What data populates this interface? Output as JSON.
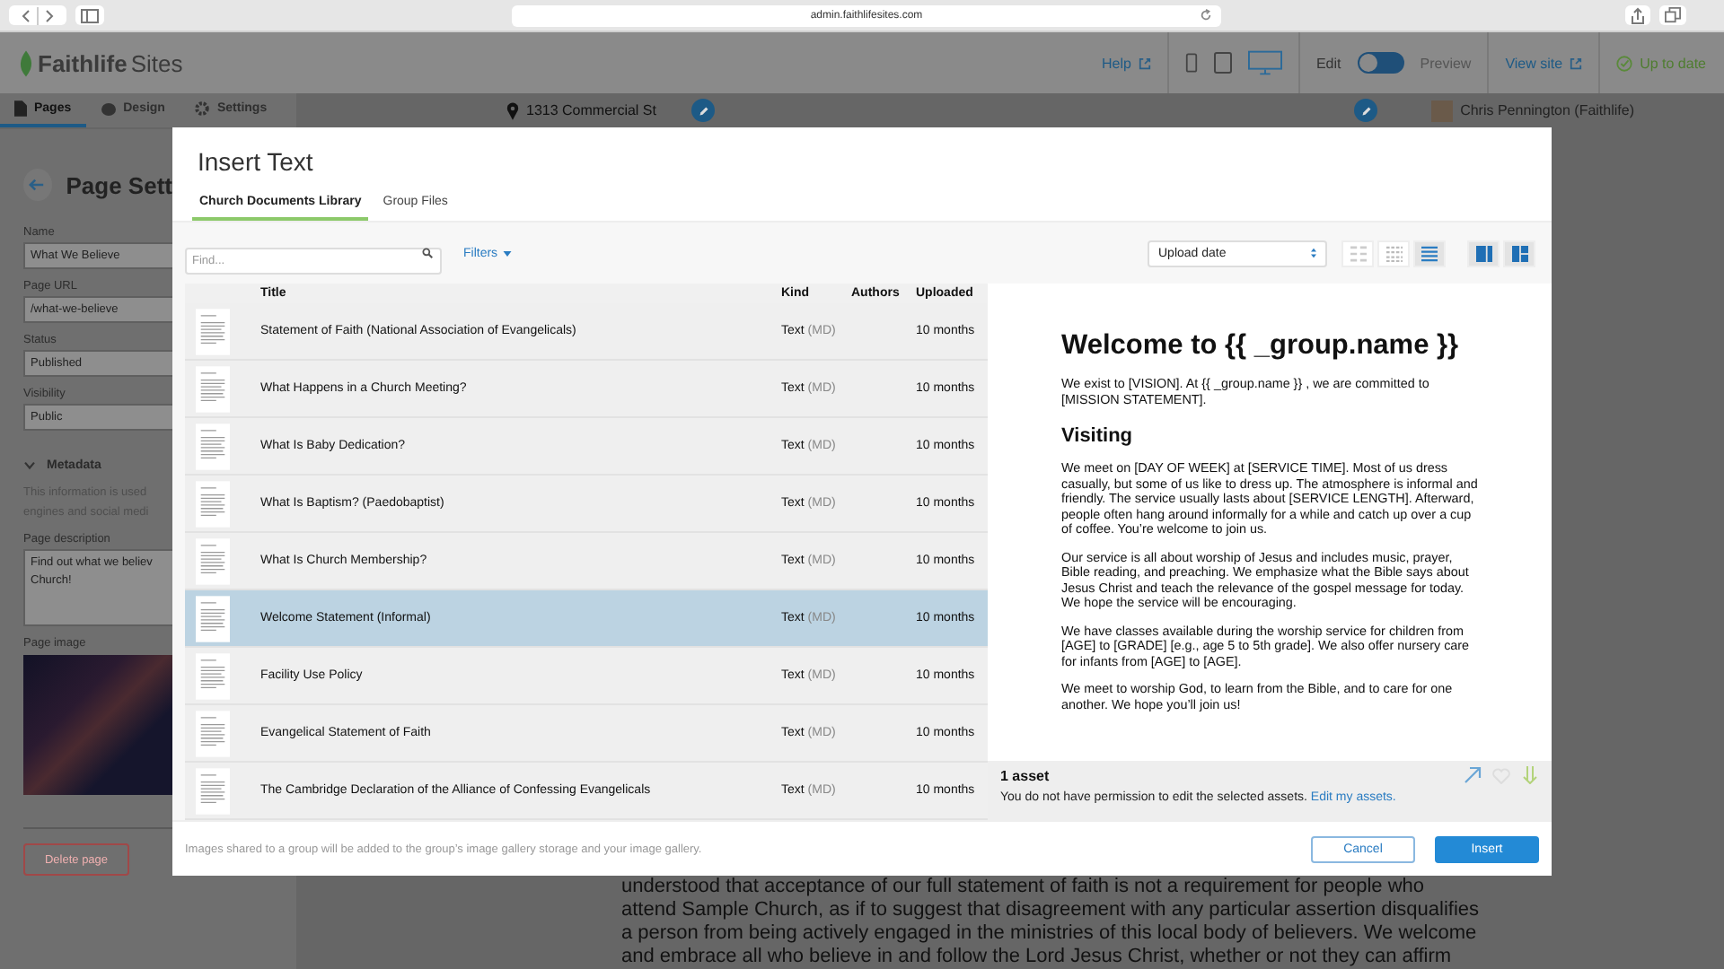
{
  "browser": {
    "url": "admin.faithlifesites.com"
  },
  "app_header": {
    "logo_bold": "Faithlife",
    "logo_light": "Sites",
    "help": "Help",
    "devices": [
      {
        "kind": "phone",
        "selected": false
      },
      {
        "kind": "tablet",
        "selected": false
      },
      {
        "kind": "desktop",
        "selected": true
      }
    ],
    "edit_label": "Edit",
    "preview_label": "Preview",
    "preview_mode": false,
    "view_site": "View site",
    "status": "Up to date"
  },
  "sidebar": {
    "tabs": [
      {
        "kind": "pages",
        "label": "Pages",
        "selected": true
      },
      {
        "kind": "design",
        "label": "Design",
        "selected": false
      },
      {
        "kind": "settings",
        "label": "Settings",
        "selected": false
      }
    ],
    "title": "Page Sett",
    "fields": [
      {
        "label": "Name",
        "value": "What We Believe"
      },
      {
        "label": "Page URL",
        "value": "/what-we-believe"
      },
      {
        "label": "Status",
        "value": "Published"
      },
      {
        "label": "Visibility",
        "value": "Public"
      }
    ],
    "metadata": {
      "label": "Metadata",
      "expanded": true
    },
    "info_lines": [
      "This information is used",
      "engines and social medi"
    ],
    "description": {
      "label": "Page description",
      "lines": [
        "Find out what we believ",
        "Church!"
      ]
    },
    "image_label": "Page image",
    "delete": "Delete page"
  },
  "main": {
    "address": "1313 Commercial St",
    "user": "Chris Pennington (Faithlife)",
    "body_lines": [
      "understood that acceptance of our full statement of faith is not a requirement for people who",
      "attend Sample Church, as if to suggest that disagreement with any particular assertion disqualifies",
      "a person from being actively engaged in the ministries of this local body of believers. We welcome",
      "and embrace all who believe in and follow the Lord Jesus Christ, whether or not they can affirm"
    ]
  },
  "modal": {
    "title": "Insert Text",
    "tabs": [
      {
        "label": "Church Documents Library",
        "selected": true
      },
      {
        "label": "Group Files",
        "selected": false
      }
    ],
    "search": {
      "placeholder": "Find..."
    },
    "filters": "Filters",
    "sort": "Upload date",
    "view_modes": [
      {
        "kind": "grid-large",
        "selected": false
      },
      {
        "kind": "grid-small",
        "selected": false
      },
      {
        "kind": "list",
        "selected": true
      }
    ],
    "panes": [
      {
        "kind": "preview",
        "on": true
      },
      {
        "kind": "split",
        "on": true
      }
    ],
    "columns": [
      "Title",
      "Kind",
      "Authors",
      "Uploaded"
    ],
    "rows": [
      {
        "title": "Statement of Faith (National Association of Evangelicals)",
        "kind": "Text",
        "format": "(MD)",
        "uploaded": "10 months",
        "selected": false
      },
      {
        "title": "What Happens in a Church Meeting?",
        "kind": "Text",
        "format": "(MD)",
        "uploaded": "10 months",
        "selected": false
      },
      {
        "title": "What Is Baby Dedication?",
        "kind": "Text",
        "format": "(MD)",
        "uploaded": "10 months",
        "selected": false
      },
      {
        "title": "What Is Baptism? (Paedobaptist)",
        "kind": "Text",
        "format": "(MD)",
        "uploaded": "10 months",
        "selected": false
      },
      {
        "title": "What Is Church Membership?",
        "kind": "Text",
        "format": "(MD)",
        "uploaded": "10 months",
        "selected": false
      },
      {
        "title": "Welcome Statement (Informal)",
        "kind": "Text",
        "format": "(MD)",
        "uploaded": "10 months",
        "selected": true
      },
      {
        "title": "Facility Use Policy",
        "kind": "Text",
        "format": "(MD)",
        "uploaded": "10 months",
        "selected": false
      },
      {
        "title": "Evangelical Statement of Faith",
        "kind": "Text",
        "format": "(MD)",
        "uploaded": "10 months",
        "selected": false
      },
      {
        "title": "The Cambridge Declaration of the Alliance of Confessing Evangelicals",
        "kind": "Text",
        "format": "(MD)",
        "uploaded": "10 months",
        "selected": false
      }
    ],
    "preview": [
      {
        "kind": "h1",
        "text": "Welcome to {{ _group.name }}"
      },
      {
        "kind": "p",
        "text": "We exist to [VISION]. At {{ _group.name }} , we are committed to [MISSION STATEMENT]."
      },
      {
        "kind": "h2",
        "text": "Visiting"
      },
      {
        "kind": "p",
        "text": "We meet on [DAY OF WEEK] at [SERVICE TIME]. Most of us dress casually, but some of us like to dress up. The atmosphere is informal and friendly. The service usually lasts about [SERVICE LENGTH]. Afterward, people often hang around informally for a while and catch up over a cup of coffee. You’re welcome to join us."
      },
      {
        "kind": "p",
        "text": "Our service is all about worship of Jesus and includes music, prayer, Bible reading, and preaching. We emphasize what the Bible says about Jesus Christ and teach the relevance of the gospel message for today. We hope the service will be encouraging."
      },
      {
        "kind": "p",
        "text": "We have classes available during the worship service for children from [AGE] to [GRADE] [e.g., age 5 to 5th grade]. We also offer nursery care for infants from [AGE] to [AGE]."
      },
      {
        "kind": "p",
        "text": "We meet to worship God, to learn from the Bible, and to care for one another. We hope you’ll join us!"
      }
    ],
    "selection": {
      "count": "1 asset",
      "message": "You do not have permission to edit the selected assets.",
      "link": "Edit my assets."
    },
    "note": "Images shared to a group will be added to the group’s image gallery storage and your image gallery.",
    "cancel": "Cancel",
    "insert": "Insert"
  }
}
